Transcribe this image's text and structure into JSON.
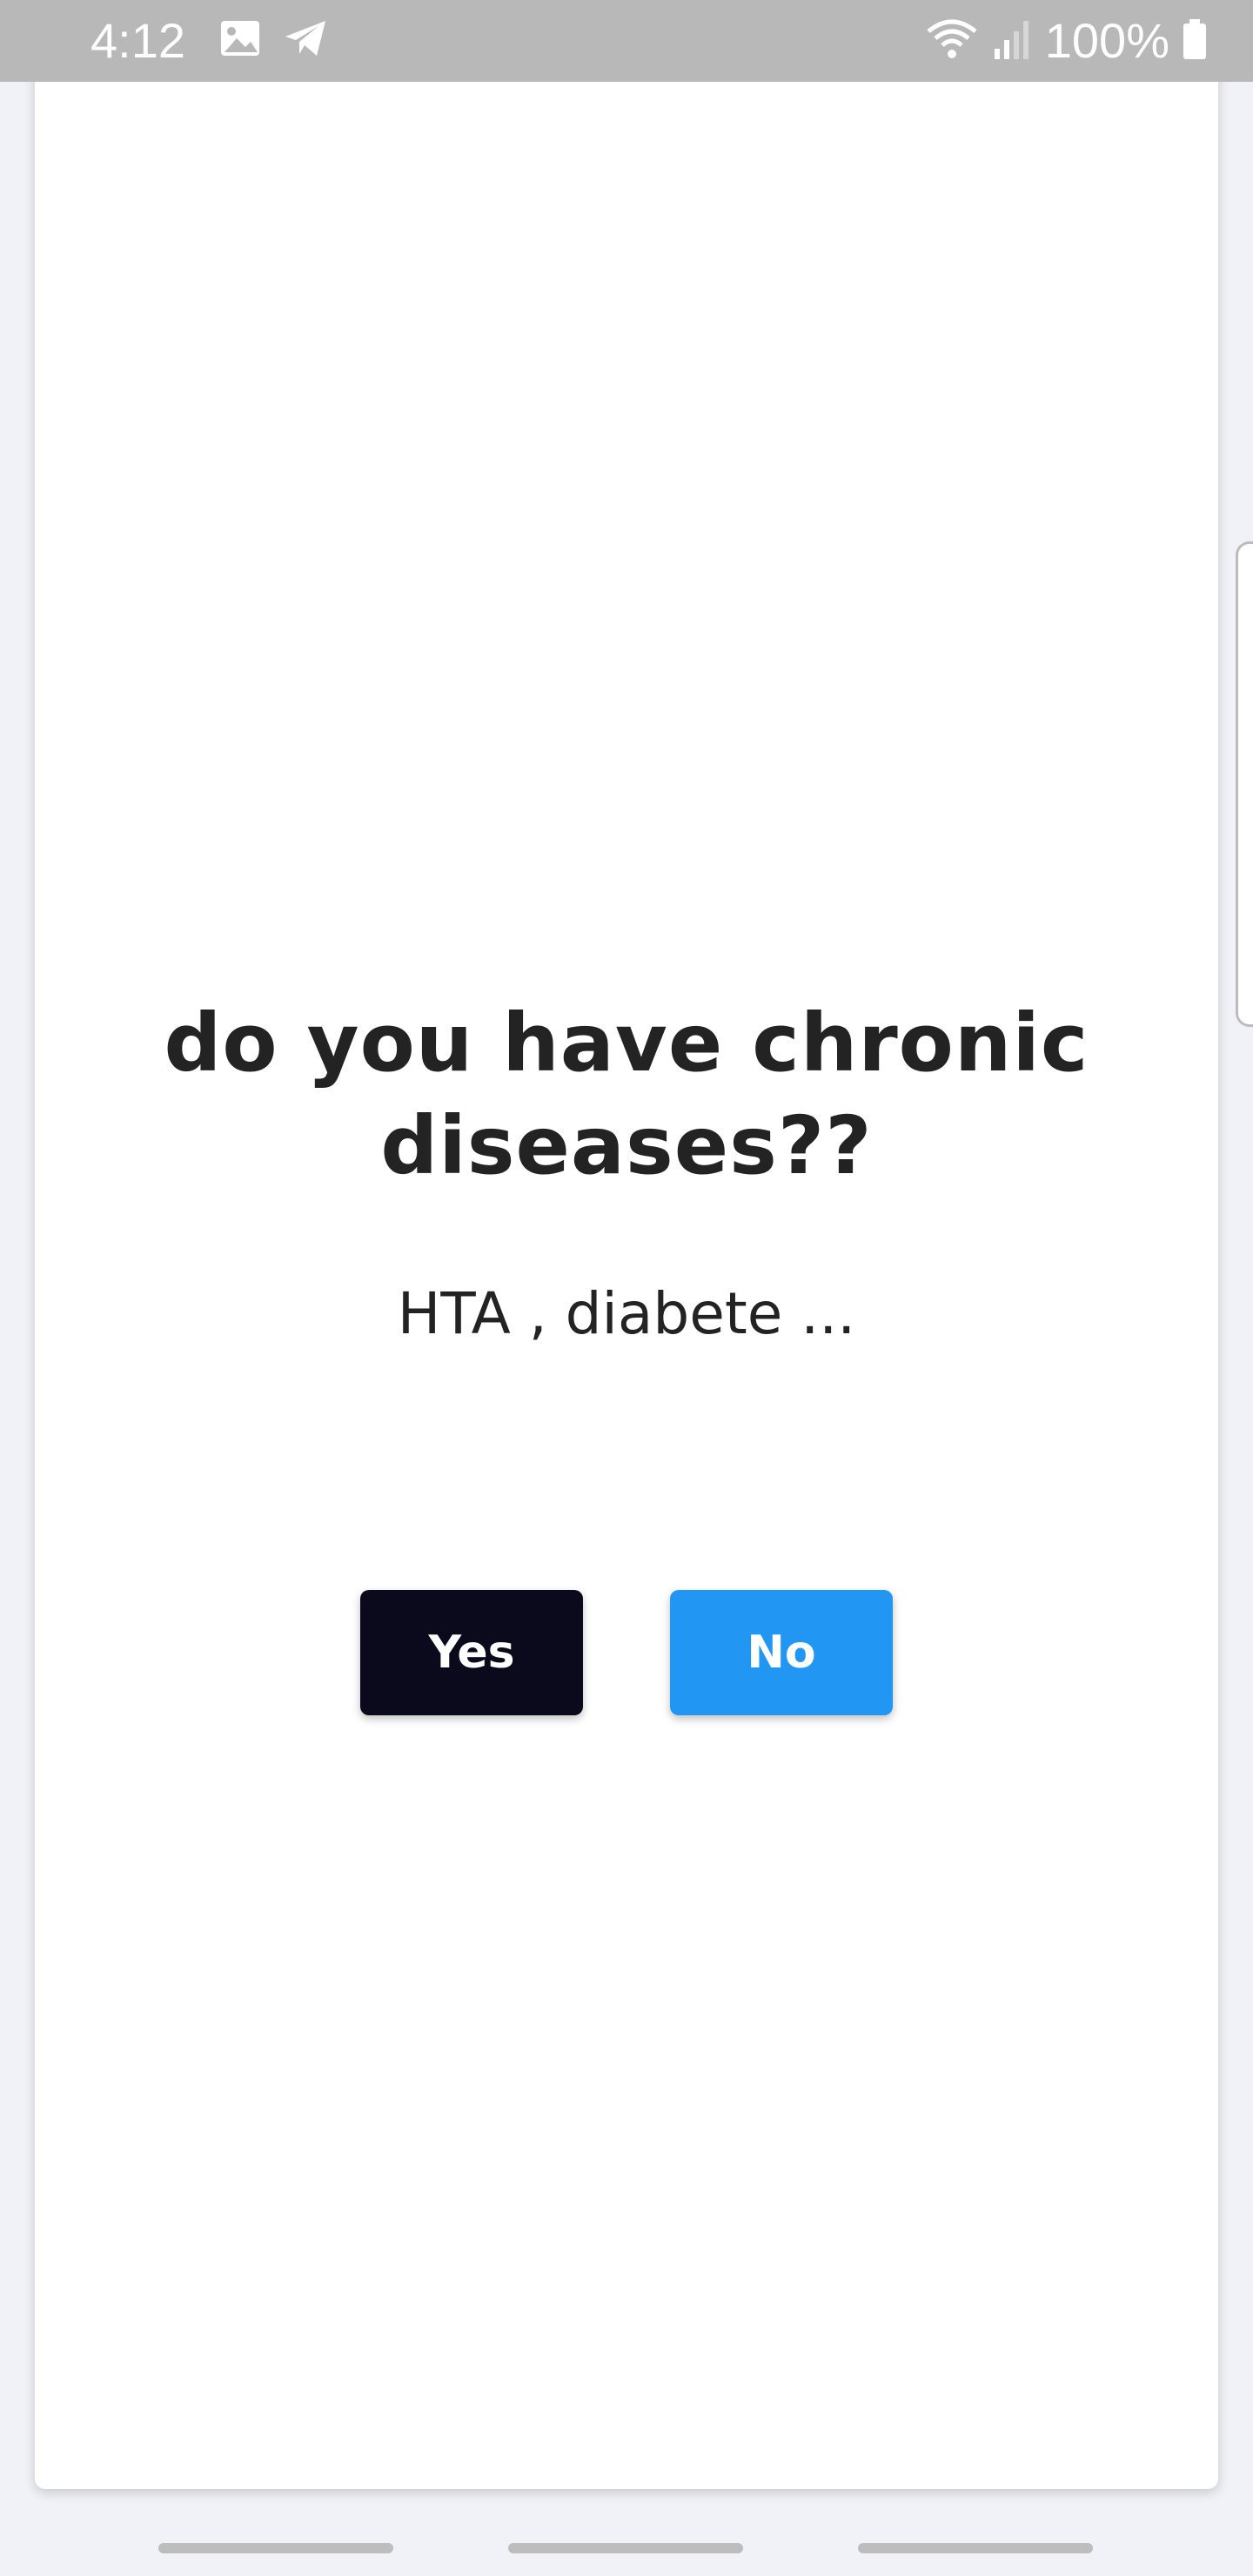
{
  "status_bar": {
    "time": "4:12",
    "battery": "100%",
    "icons": [
      "image-icon",
      "telegram-icon",
      "wifi-icon",
      "signal-icon",
      "battery-icon"
    ]
  },
  "dialog": {
    "question": "do you have chronic diseases??",
    "hint": "HTA , diabete ...",
    "yes_label": "Yes",
    "no_label": "No"
  },
  "colors": {
    "yes_button": "#0b0a1c",
    "no_button": "#2196f3",
    "text": "#232323",
    "background": "#f1f2f7"
  },
  "nav_bar": {
    "items": [
      "recent-apps",
      "home",
      "back"
    ]
  }
}
